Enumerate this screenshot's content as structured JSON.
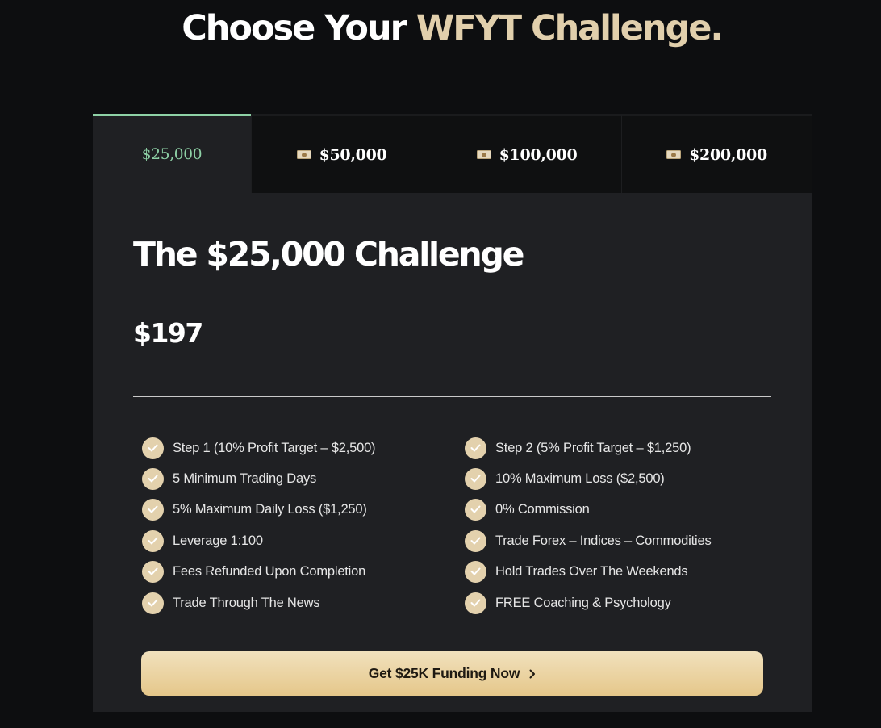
{
  "hero": {
    "title_lead": "Choose Your ",
    "title_accent": "WFYT Challenge."
  },
  "tabs": [
    {
      "label": "$25,000",
      "icon": "money-icon",
      "active": true
    },
    {
      "label": "$50,000",
      "icon": "money-icon",
      "active": false
    },
    {
      "label": "$100,000",
      "icon": "money-icon",
      "active": false
    },
    {
      "label": "$200,000",
      "icon": "money-icon",
      "active": false
    }
  ],
  "plan": {
    "title": "The $25,000 Challenge",
    "price": "$197"
  },
  "features": {
    "left": [
      "Step 1 (10% Profit Target – $2,500)",
      "5 Minimum Trading Days",
      "5% Maximum Daily Loss ($1,250)",
      "Leverage 1:100",
      "Fees Refunded Upon Completion",
      "Trade Through The News"
    ],
    "right": [
      "Step 2 (5% Profit Target – $1,250)",
      "10% Maximum Loss ($2,500)",
      "0% Commission",
      "Trade Forex – Indices – Commodities",
      "Hold Trades Over The Weekends",
      "FREE Coaching & Psychology"
    ]
  },
  "cta": {
    "label": "Get $25K Funding Now"
  },
  "colors": {
    "background": "#0d0e10",
    "card": "#1f2023",
    "accent_gold": "#e1cfac",
    "active_tab_green": "#8ed1a6",
    "button_gradient_top": "#f1e1bd",
    "button_gradient_bottom": "#e5c78a"
  }
}
